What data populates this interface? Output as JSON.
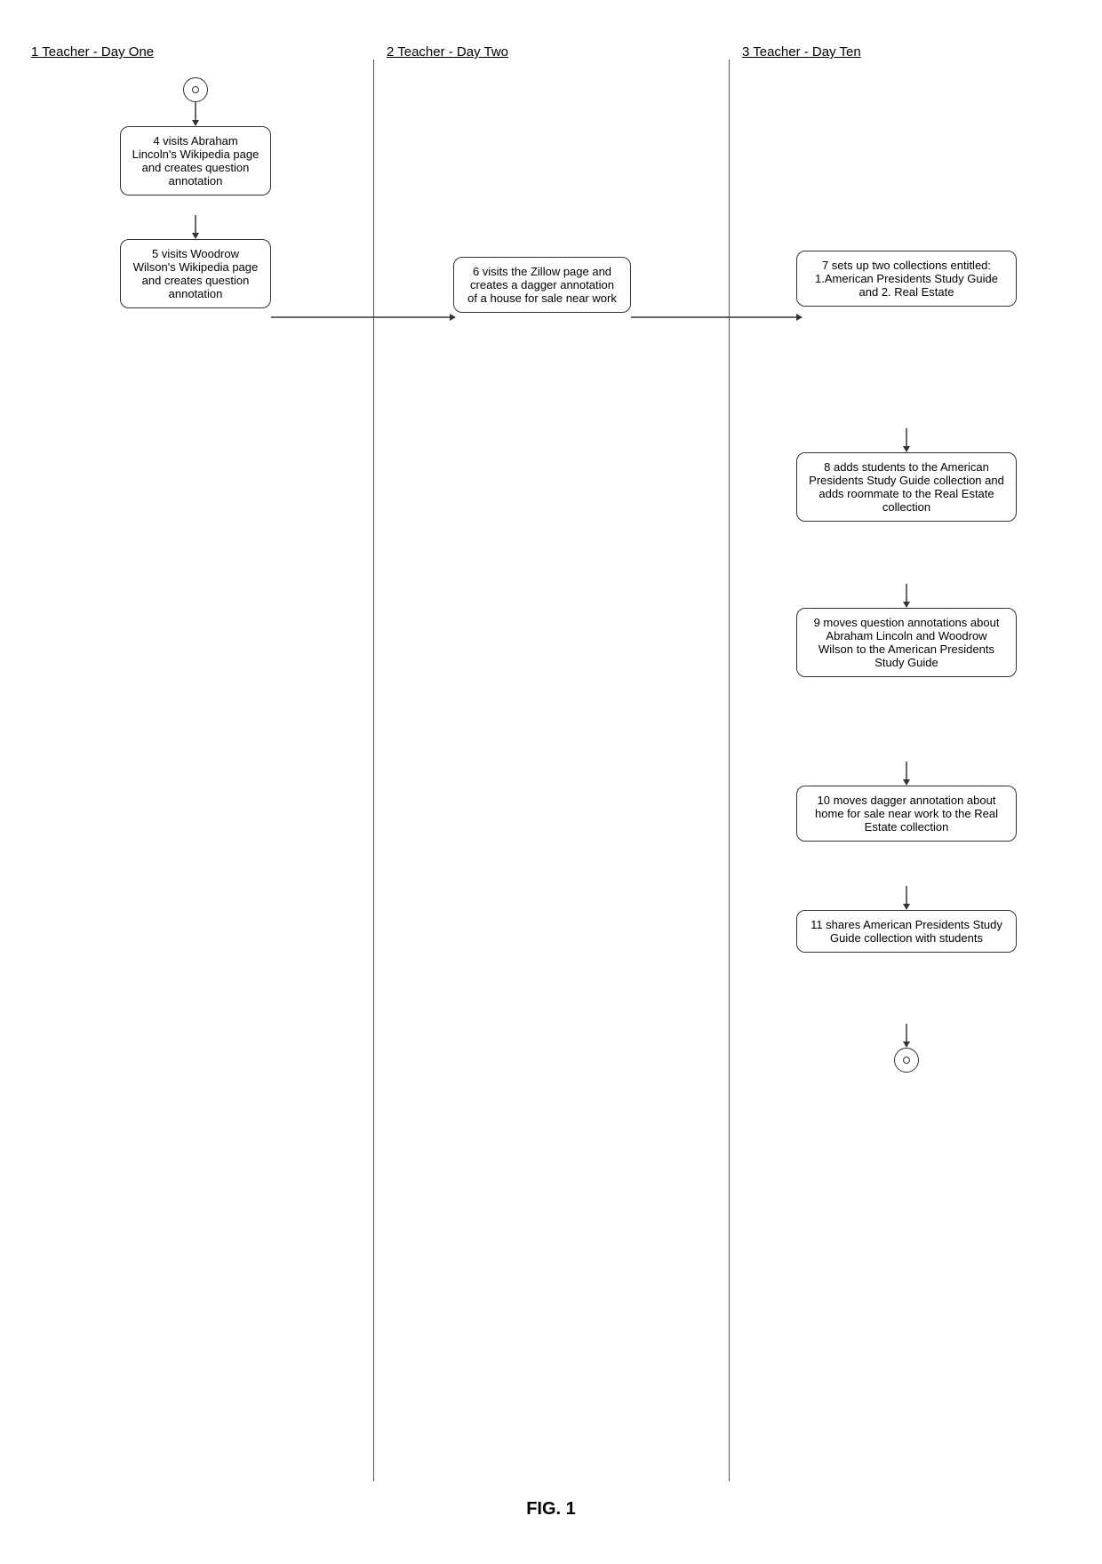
{
  "title": "FIG. 1",
  "columns": [
    {
      "id": "col1",
      "label": "1 Teacher - Day One",
      "number": "1"
    },
    {
      "id": "col2",
      "label": "2 Teacher - Day Two",
      "number": "2"
    },
    {
      "id": "col3",
      "label": "3 Teacher - Day Ten",
      "number": "3"
    }
  ],
  "nodes": [
    {
      "id": "start1",
      "type": "circle",
      "column": 1,
      "label": ""
    },
    {
      "id": "node4",
      "type": "box",
      "column": 1,
      "number": "4",
      "text": "4 visits Abraham Lincoln's Wikipedia page and creates question annotation"
    },
    {
      "id": "node5",
      "type": "box",
      "column": 1,
      "number": "5",
      "text": "5 visits Woodrow Wilson's Wikipedia page and creates question annotation"
    },
    {
      "id": "node6",
      "type": "box",
      "column": 2,
      "number": "6",
      "text": "6 visits the Zillow page and creates a dagger annotation of a house for sale near work"
    },
    {
      "id": "node7",
      "type": "box",
      "column": 3,
      "number": "7",
      "text": "7 sets up two collections entitled: 1.American Presidents Study Guide and 2. Real Estate"
    },
    {
      "id": "node8",
      "type": "box",
      "column": 3,
      "number": "8",
      "text": "8 adds students to the American Presidents Study Guide collection and adds roommate to the Real Estate collection"
    },
    {
      "id": "node9",
      "type": "box",
      "column": 3,
      "number": "9",
      "text": "9 moves question annotations about Abraham Lincoln and Woodrow Wilson to the American Presidents Study Guide"
    },
    {
      "id": "node10",
      "type": "box",
      "column": 3,
      "number": "10",
      "text": "10 moves dagger annotation about home for sale near work to the Real Estate collection"
    },
    {
      "id": "node11",
      "type": "box",
      "column": 3,
      "number": "11",
      "text": "11 shares American Presidents Study Guide collection with students"
    },
    {
      "id": "end3",
      "type": "circle",
      "column": 3,
      "label": ""
    }
  ],
  "fig_label": "FIG. 1"
}
